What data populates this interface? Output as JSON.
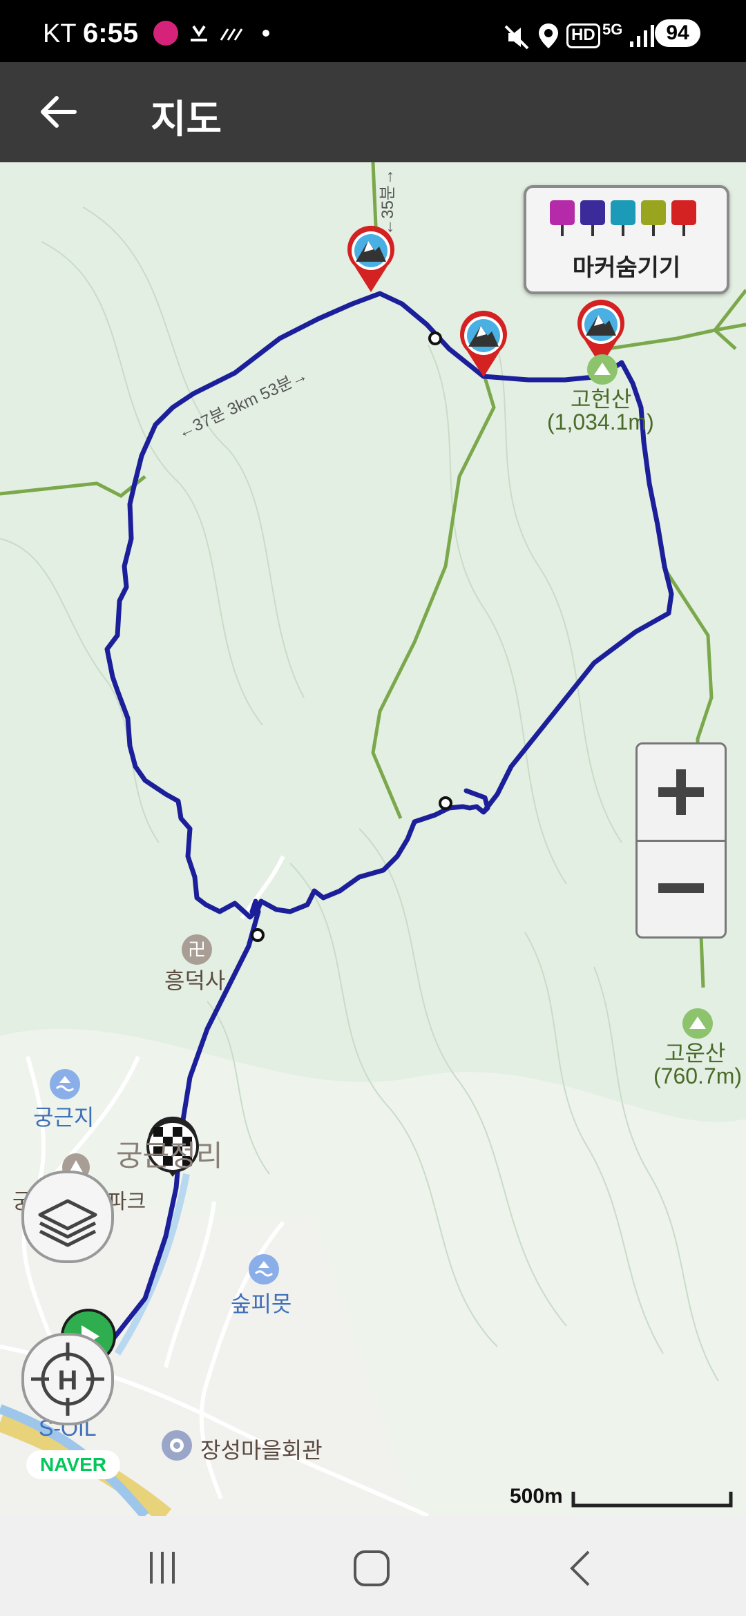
{
  "status_bar": {
    "carrier": "KT",
    "time": "6:55",
    "network": "5G",
    "hd": "HD",
    "battery": "94"
  },
  "app_bar": {
    "title": "지도"
  },
  "marker_panel": {
    "label": "마커숨기기",
    "chip_colors": [
      "#b52aa8",
      "#3a2a9a",
      "#1b9bb7",
      "#9aa51f",
      "#d42121"
    ]
  },
  "map": {
    "places": {
      "peak1_name": "고헌산",
      "peak1_elev": "(1,034.1m)",
      "peak2_name": "고운산",
      "peak2_elev": "(760.7m)",
      "temple": "흥덕사",
      "reservoir1": "궁근지",
      "village": "궁근정리",
      "park": "궁근정캠핑파크",
      "reservoir2": "숲피못",
      "gas_station": "S-OIL",
      "hall": "장성마을회관"
    },
    "trail_labels": {
      "upper": "←35분→",
      "mid": "←37분 3km 53분→"
    },
    "route_color": "#1c1f9a",
    "trail_color": "#7aa84a",
    "scale_label": "500m",
    "provider": "NAVER"
  },
  "icons": {
    "back": "arrow-left-icon",
    "zoom_in": "plus-icon",
    "zoom_out": "minus-icon",
    "layers": "layers-icon",
    "home_locate": "target-icon",
    "nav_recent": "recent-apps-icon",
    "nav_home": "home-icon",
    "nav_back": "back-icon"
  }
}
